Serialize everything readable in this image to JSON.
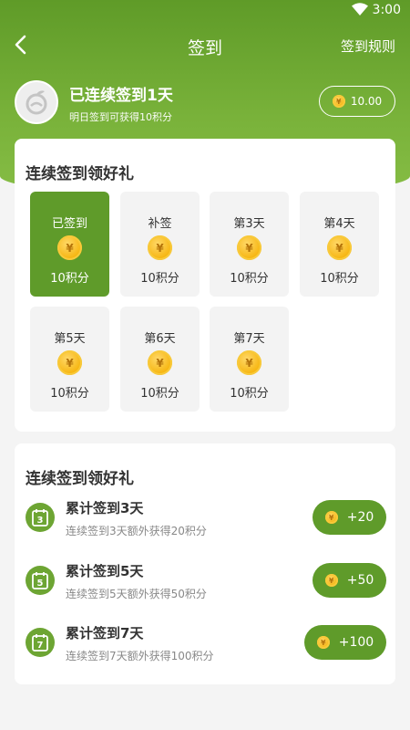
{
  "status_bar": {
    "time": "3:00"
  },
  "nav": {
    "title": "签到",
    "rules_link": "签到规则"
  },
  "profile": {
    "headline": "已连续签到1天",
    "subline": "明日签到可获得10积分",
    "balance": "10.00"
  },
  "coin_symbol": "¥",
  "checkin_card": {
    "title": "连续签到领好礼",
    "days": [
      {
        "label": "已签到",
        "points": "10积分",
        "state": "checked"
      },
      {
        "label": "补签",
        "points": "10积分",
        "state": "makeup"
      },
      {
        "label": "第3天",
        "points": "10积分",
        "state": "pending"
      },
      {
        "label": "第4天",
        "points": "10积分",
        "state": "pending"
      },
      {
        "label": "第5天",
        "points": "10积分",
        "state": "pending"
      },
      {
        "label": "第6天",
        "points": "10积分",
        "state": "pending"
      },
      {
        "label": "第7天",
        "points": "10积分",
        "state": "pending"
      }
    ]
  },
  "rewards_card": {
    "title": "连续签到领好礼",
    "items": [
      {
        "day_number": "3",
        "title": "累计签到3天",
        "description": "连续签到3天额外获得20积分",
        "bonus": "+20"
      },
      {
        "day_number": "5",
        "title": "累计签到5天",
        "description": "连续签到5天额外获得50积分",
        "bonus": "+50"
      },
      {
        "day_number": "7",
        "title": "累计签到7天",
        "description": "连续签到7天额外获得100积分",
        "bonus": "+100"
      }
    ]
  },
  "colors": {
    "primary_green": "#5f9b2a",
    "header_green": "#79b23a",
    "coin_gold": "#f6b40d",
    "background": "#f4f4f4"
  },
  "icons": {
    "back": "chevron-left-icon",
    "wifi": "wifi-icon",
    "avatar": "default-avatar-icon",
    "coin": "coin-icon",
    "calendar": "calendar-icon"
  }
}
